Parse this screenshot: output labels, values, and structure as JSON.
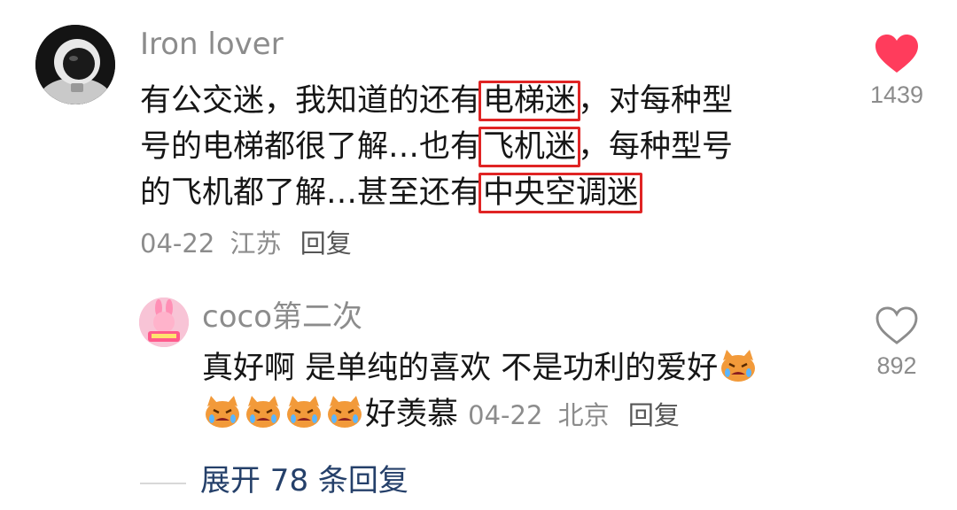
{
  "comment": {
    "username": "Iron lover",
    "text_before_1": "有公交迷，我知道的还有",
    "highlight_1": "电梯迷",
    "text_after_1": "，对每种型",
    "text_line2_start": "号的电梯都很了解…也有",
    "highlight_2": "飞机迷",
    "text_line2_after": "，每种型号",
    "text_line3_start": "的飞机都了解…甚至还有",
    "highlight_3": "中央空调迷",
    "date": "04-22",
    "region": "江苏",
    "reply_label": "回复",
    "like_count": "1439",
    "liked": true,
    "like_color": "#ff3c5c"
  },
  "reply": {
    "username": "coco第二次",
    "text_line1": "真好啊 是单纯的喜欢 不是功利的爱好",
    "text_line2_suffix": "好羡慕",
    "date": "04-22",
    "region": "北京",
    "reply_label": "回复",
    "like_count": "892",
    "liked": false
  },
  "expand_replies": "展开 78 条回复"
}
